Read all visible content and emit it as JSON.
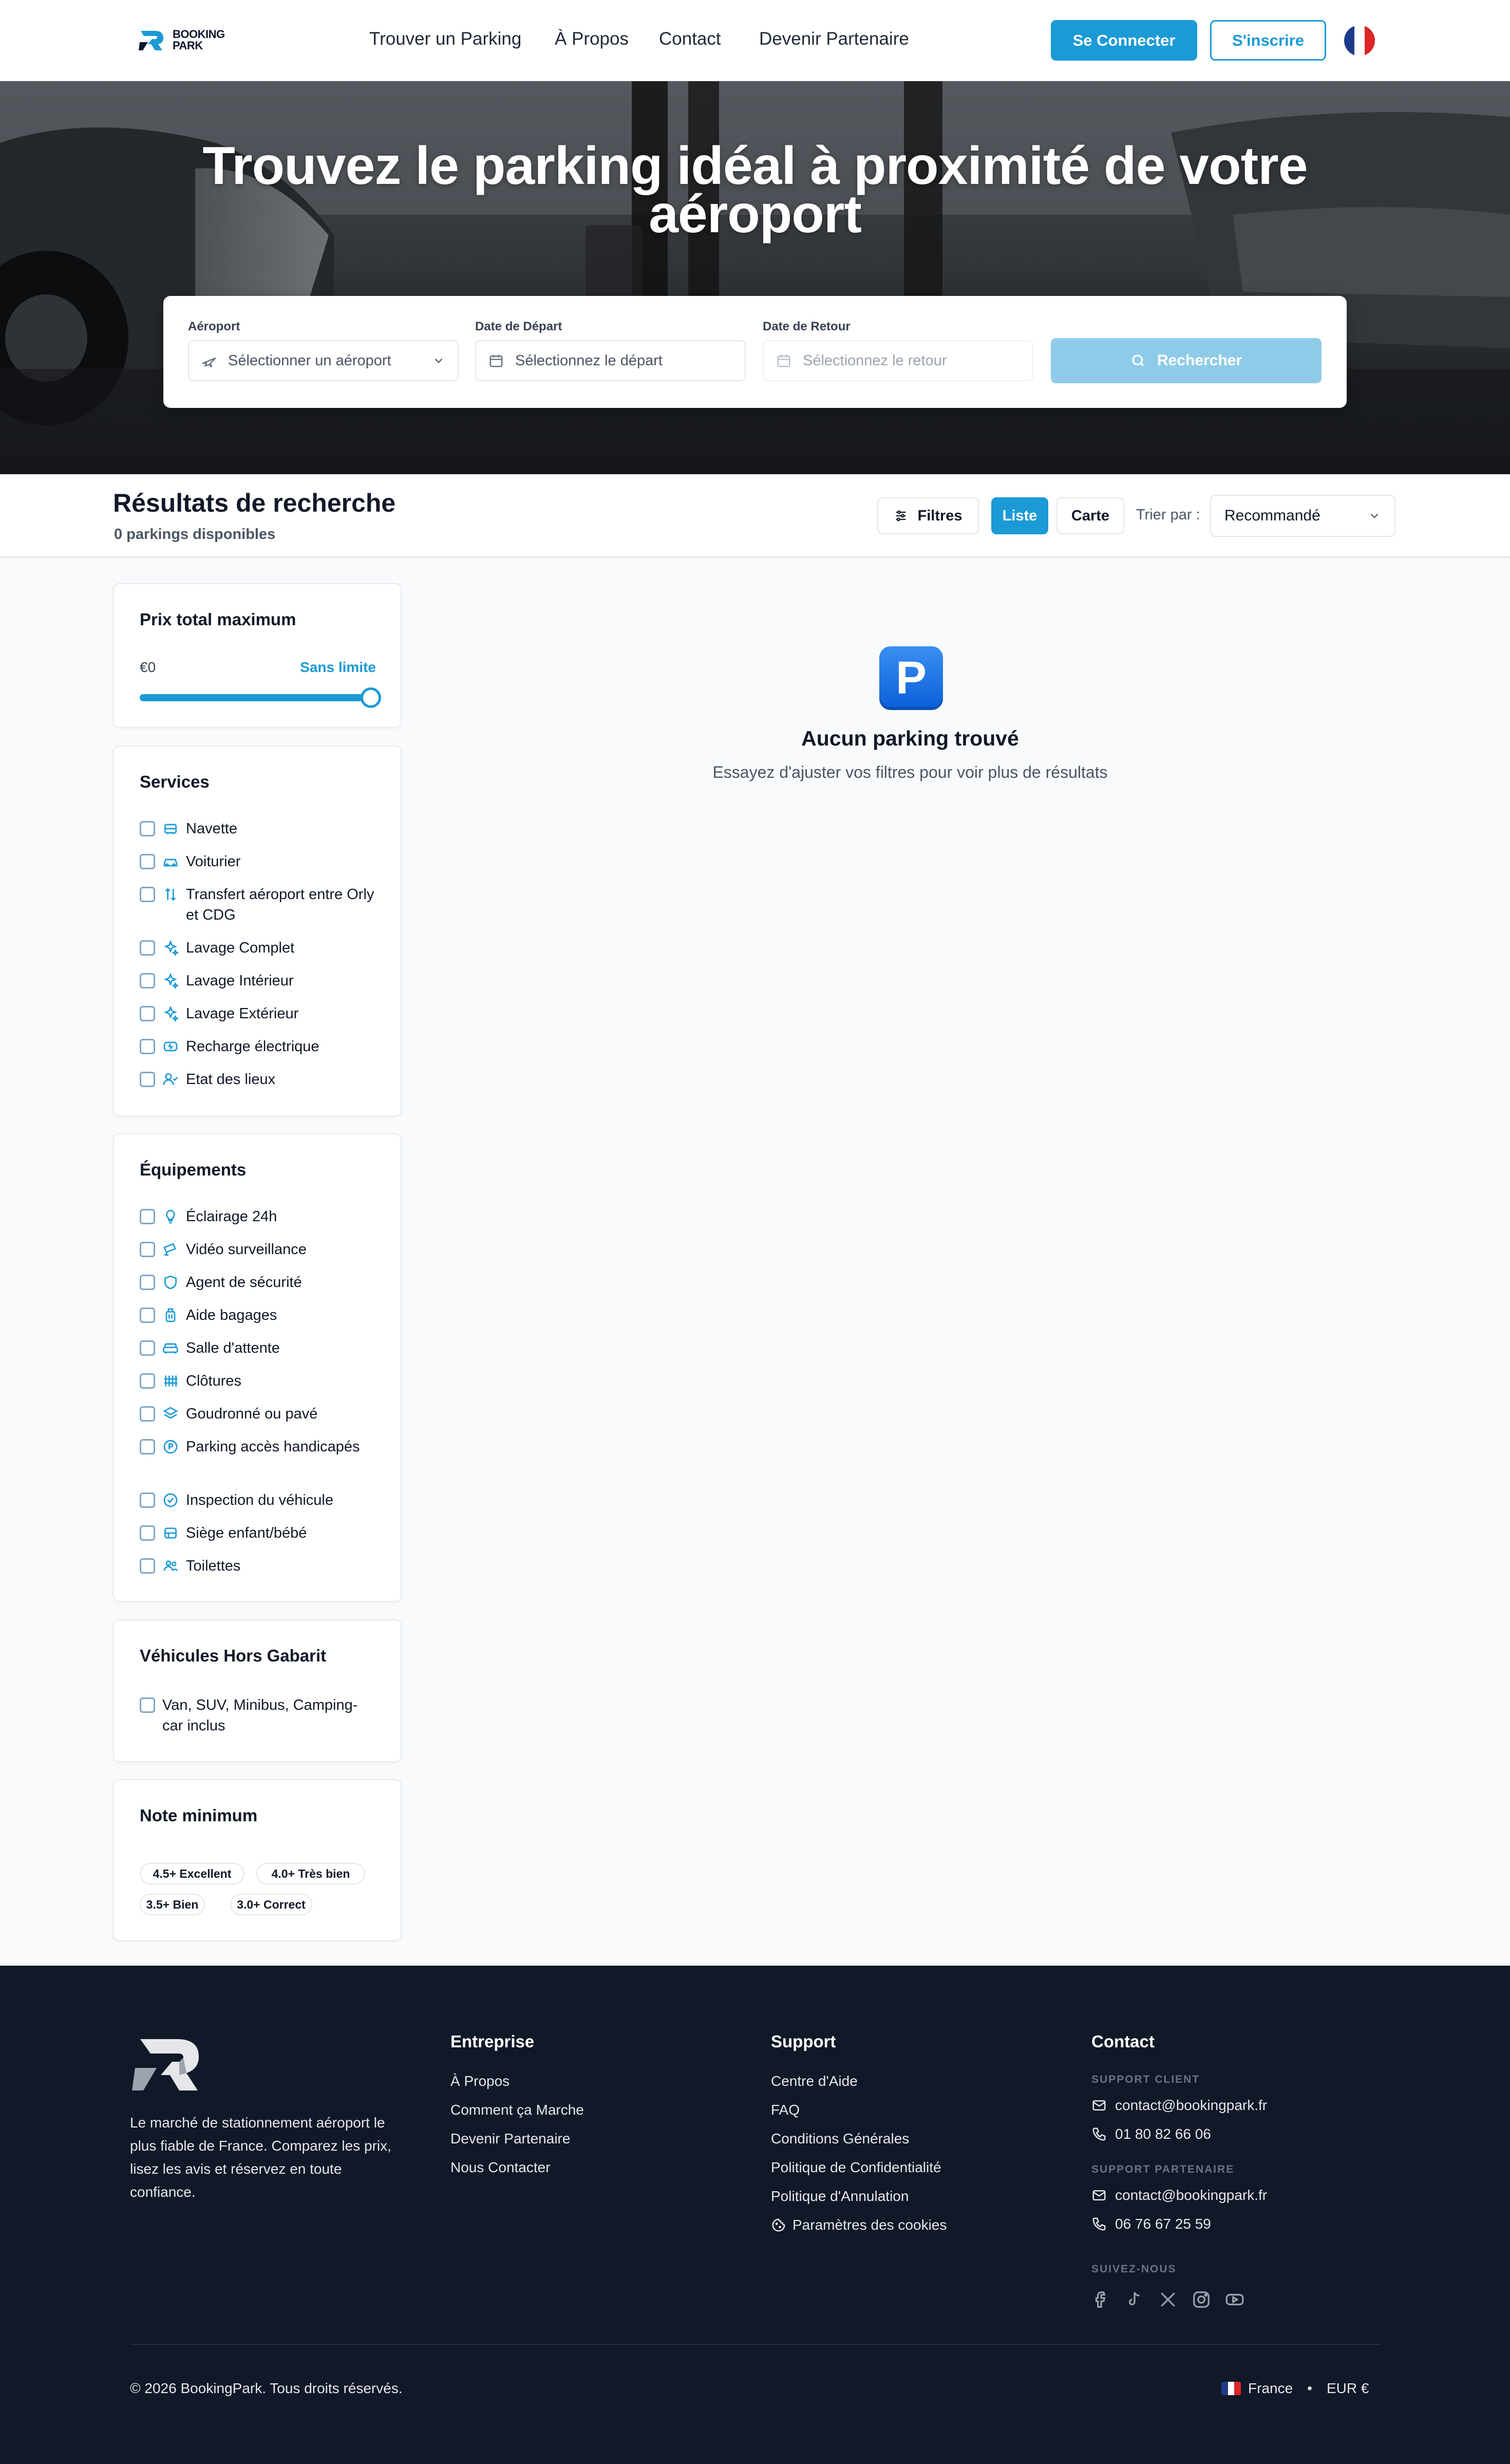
{
  "brand": {
    "logo_text_1": "BOOKING",
    "logo_text_2": "PARK"
  },
  "nav": {
    "items": [
      "Trouver un Parking",
      "À Propos",
      "Contact",
      "Devenir Partenaire"
    ],
    "login": "Se Connecter",
    "signup": "S'inscrire",
    "language_flag": "flag-france-icon"
  },
  "hero": {
    "title_line1": "Trouvez le parking idéal à proximité de votre",
    "title_line2": "aéroport"
  },
  "search": {
    "airport_label": "Aéroport",
    "airport_placeholder": "Sélectionner un aéroport",
    "departure_label": "Date de Départ",
    "departure_placeholder": "Sélectionnez le départ",
    "return_label": "Date de Retour",
    "return_placeholder": "Sélectionnez le retour",
    "button": "Rechercher"
  },
  "results": {
    "title": "Résultats de recherche",
    "count": "0 parkings disponibles",
    "filters_btn": "Filtres",
    "list_btn": "Liste",
    "map_btn": "Carte",
    "sort_label": "Trier par :",
    "sort_value": "Recommandé"
  },
  "filters": {
    "price": {
      "title": "Prix total maximum",
      "min": "€0",
      "max": "Sans limite",
      "value_fraction": 1.0
    },
    "services": {
      "title": "Services",
      "items": [
        {
          "label": "Navette",
          "icon": "bus-icon"
        },
        {
          "label": "Voiturier",
          "icon": "car-icon"
        },
        {
          "label": "Transfert aéroport entre Orly et CDG",
          "icon": "arrows-updown-icon"
        },
        {
          "label": "Lavage Complet",
          "icon": "sparkles-icon"
        },
        {
          "label": "Lavage Intérieur",
          "icon": "sparkles-icon"
        },
        {
          "label": "Lavage Extérieur",
          "icon": "sparkles-icon"
        },
        {
          "label": "Recharge électrique",
          "icon": "ev-charge-icon"
        },
        {
          "label": "Etat des lieux",
          "icon": "user-check-icon"
        }
      ]
    },
    "equipment": {
      "title": "Équipements",
      "items": [
        {
          "label": "Éclairage 24h",
          "icon": "lightbulb-icon"
        },
        {
          "label": "Vidéo surveillance",
          "icon": "cctv-icon"
        },
        {
          "label": "Agent de sécurité",
          "icon": "shield-icon"
        },
        {
          "label": "Aide bagages",
          "icon": "luggage-icon"
        },
        {
          "label": "Salle d'attente",
          "icon": "sofa-icon"
        },
        {
          "label": "Clôtures",
          "icon": "fence-icon"
        },
        {
          "label": "Goudronné ou pavé",
          "icon": "layers-icon"
        },
        {
          "label": "Parking accès handicapés",
          "icon": "parking-circle-icon"
        },
        {
          "label": "Inspection du véhicule",
          "icon": "check-circle-icon"
        },
        {
          "label": "Siège enfant/bébé",
          "icon": "baby-seat-icon"
        },
        {
          "label": "Toilettes",
          "icon": "users-icon"
        }
      ]
    },
    "oversize": {
      "title": "Véhicules Hors Gabarit",
      "items": [
        {
          "label": "Van, SUV, Minibus, Camping-car inclus"
        }
      ]
    },
    "rating": {
      "title": "Note minimum",
      "options": [
        "4.5+ Excellent",
        "4.0+ Très bien",
        "3.5+ Bien",
        "3.0+ Correct"
      ]
    }
  },
  "empty": {
    "icon": "P",
    "title": "Aucun parking trouvé",
    "subtitle": "Essayez d'ajuster vos filtres pour voir plus de résultats"
  },
  "footer": {
    "description": "Le marché de stationnement aéroport le plus fiable de France. Comparez les prix, lisez les avis et réservez en toute confiance.",
    "company": {
      "title": "Entreprise",
      "links": [
        "À Propos",
        "Comment ça Marche",
        "Devenir Partenaire",
        "Nous Contacter"
      ]
    },
    "support": {
      "title": "Support",
      "links": [
        "Centre d'Aide",
        "FAQ",
        "Conditions Générales",
        "Politique de Confidentialité",
        "Politique d'Annulation",
        "Paramètres des cookies"
      ]
    },
    "contact": {
      "title": "Contact",
      "client_label": "SUPPORT CLIENT",
      "client_email": "contact@bookingpark.fr",
      "client_phone": "01 80 82 66 06",
      "partner_label": "SUPPORT PARTENAIRE",
      "partner_email": "contact@bookingpark.fr",
      "partner_phone": "06 76 67 25 59",
      "social_label": "SUIVEZ-NOUS",
      "social": [
        "facebook-icon",
        "tiktok-icon",
        "x-icon",
        "instagram-icon",
        "youtube-icon"
      ]
    },
    "copyright": "© 2026 BookingPark. Tous droits réservés.",
    "country": "France",
    "currency": "EUR €",
    "separator": "•"
  },
  "colors": {
    "primary": "#1b9ad6",
    "primary_light": "#8fcbe8",
    "footer_bg": "#111827"
  }
}
